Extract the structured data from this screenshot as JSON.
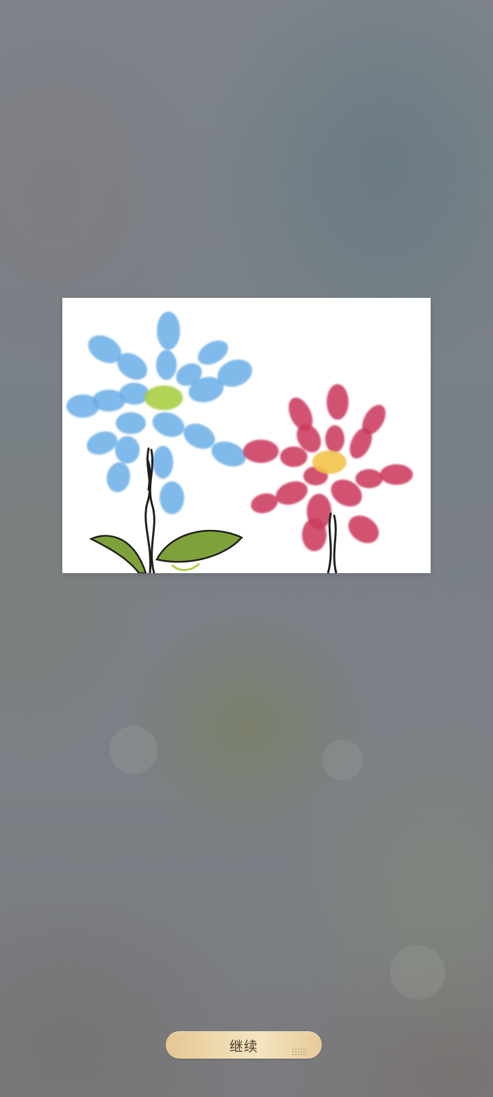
{
  "screen": {
    "continue_label": "继续"
  },
  "drawing": {
    "colors": {
      "blue_petals": "#6aaee6",
      "blue_center": "#a8cf43",
      "red_petals": "#cc3b5e",
      "red_center": "#f2c24b",
      "stem": "#1e1e1e",
      "leaf": "#7fa13a"
    }
  },
  "button": {
    "color_start": "#e3c793",
    "color_end": "#f4e4bf"
  }
}
